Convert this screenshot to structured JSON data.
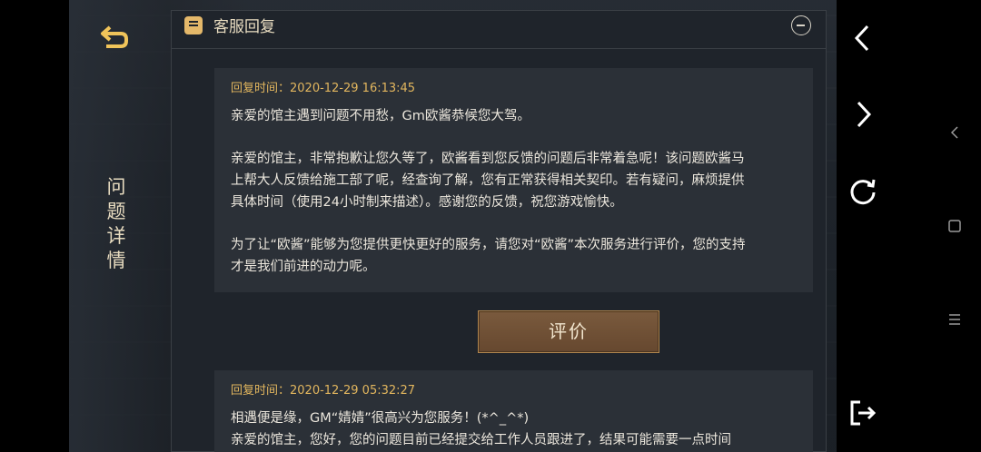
{
  "sidebar": {
    "back_icon": "back-arrow-icon",
    "vertical_title": [
      "问",
      "题",
      "详",
      "情"
    ]
  },
  "panel": {
    "title": "客服回复",
    "title_icon": "chat-bubble-icon",
    "collapse_icon": "minus-circle-icon"
  },
  "replies": [
    {
      "time": "回复时间：2020-12-29 16:13:45",
      "lines": [
        "亲爱的馆主遇到问题不用愁，Gm欧酱恭候您大驾。",
        "",
        "亲爱的馆主，非常抱歉让您久等了，欧酱看到您反馈的问题后非常着急呢！该问题欧酱马",
        "上帮大人反馈给施工部了呢，经查询了解，您有正常获得相关契印。若有疑问，麻烦提供",
        "具体时间（使用24小时制来描述）。感谢您的反馈，祝您游戏愉快。",
        "",
        "为了让“欧酱”能够为您提供更快更好的服务，请您对“欧酱”本次服务进行评价，您的支持",
        "才是我们前进的动力呢。"
      ]
    },
    {
      "time": "回复时间：2020-12-29 05:32:27",
      "lines": [
        "相遇便是缘，GM“婧婧”很高兴为您服务！(*^_^*)",
        "亲爱的馆主，您好，您的问题目前已经提交给工作人员跟进了，结果可能需要一点时间"
      ]
    }
  ],
  "rate_button": {
    "label": "评价"
  },
  "right_controls": {
    "back_icon": "chevron-left-icon",
    "forward_icon": "chevron-right-icon",
    "refresh_icon": "refresh-icon",
    "exit_icon": "exit-icon"
  },
  "system_nav": {
    "back_icon": "nav-back-icon",
    "home_icon": "nav-home-icon",
    "menu_icon": "nav-menu-icon"
  },
  "colors": {
    "accent_gold": "#e2b65e",
    "panel_bg": "#1f242b",
    "card_bg": "#2b3037",
    "button_brown": "#6e4f34"
  }
}
